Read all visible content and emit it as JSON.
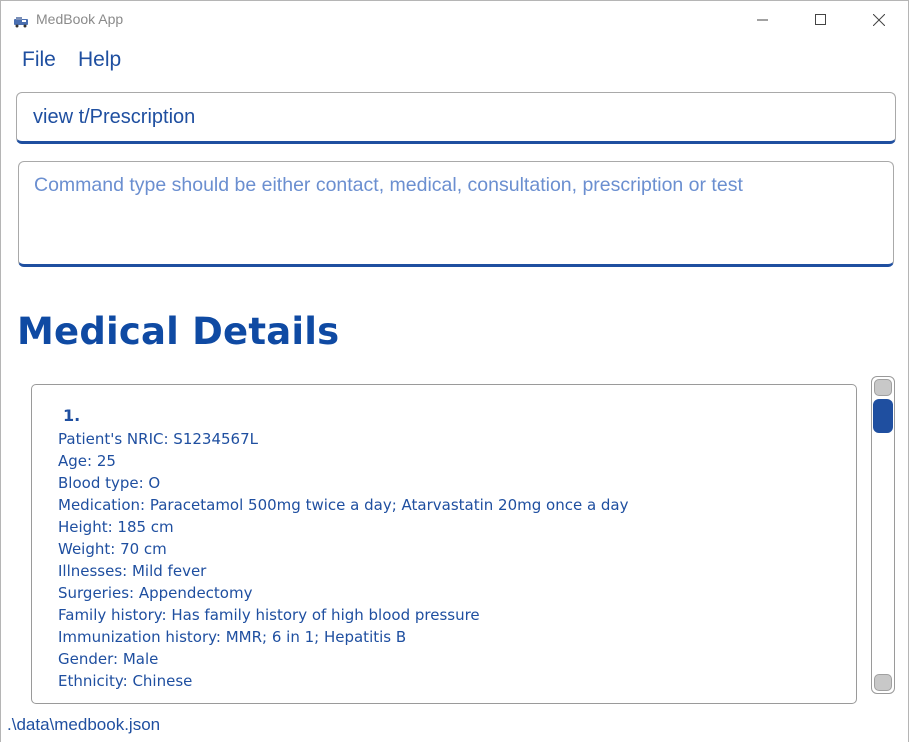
{
  "window": {
    "title": "MedBook App",
    "icon": "medbook-app-icon"
  },
  "menu": {
    "items": [
      "File",
      "Help"
    ]
  },
  "command": {
    "value": "view t/Prescription"
  },
  "result": {
    "message": "Command type should be either contact, medical, consultation, prescription or test"
  },
  "section": {
    "title": "Medical Details"
  },
  "records": [
    {
      "index": "1.",
      "lines": [
        "Patient's NRIC: S1234567L",
        "Age: 25",
        "Blood type: O",
        "Medication: Paracetamol 500mg twice a day; Atarvastatin 20mg once a day",
        "Height: 185 cm",
        "Weight: 70 cm",
        "Illnesses: Mild fever",
        "Surgeries: Appendectomy",
        "Family history: Has family history of high blood pressure",
        "Immunization history: MMR; 6 in 1; Hepatitis B",
        "Gender: Male",
        "Ethnicity: Chinese"
      ]
    }
  ],
  "status": {
    "file_path": ".\\data\\medbook.json"
  },
  "colors": {
    "accent": "#1f4fa0",
    "result_text": "#6b8fd0",
    "border": "#a9a9a9"
  }
}
